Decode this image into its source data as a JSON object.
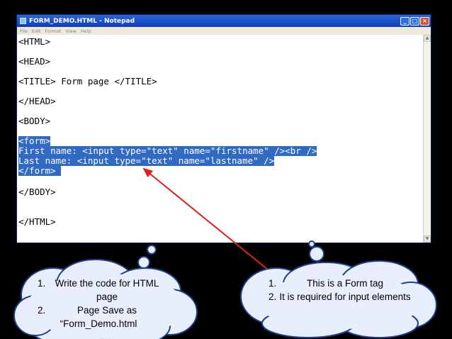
{
  "window": {
    "title": "FORM_DEMO.HTML - Notepad",
    "menu": [
      "File",
      "Edit",
      "Format",
      "View",
      "Help"
    ],
    "minimize_icon": "minimize-icon",
    "maximize_icon": "maximize-icon",
    "close_icon": "close-icon"
  },
  "editor": {
    "lines": [
      "<HTML>",
      "<HEAD>",
      "<TITLE> Form page </TITLE>",
      "</HEAD>",
      "<BODY>",
      "<form>",
      "First name: <input type=\"text\" name=\"firstname\" /><br />",
      "Last name: <input type=\"text\" name=\"lastname\" />",
      "</form> ",
      "</BODY>",
      "</HTML>"
    ]
  },
  "callouts": {
    "left": {
      "items": [
        "Write the code for HTML page",
        "Page Save as"
      ],
      "extra": "“Form_Demo.html"
    },
    "right": {
      "items": [
        "This is a Form tag",
        "It is required for input elements"
      ]
    }
  },
  "colors": {
    "selection": "#316ac5",
    "arrow": "#e02020",
    "cloud_fill": "#e8eefc",
    "cloud_stroke": "#1f3f8a"
  }
}
